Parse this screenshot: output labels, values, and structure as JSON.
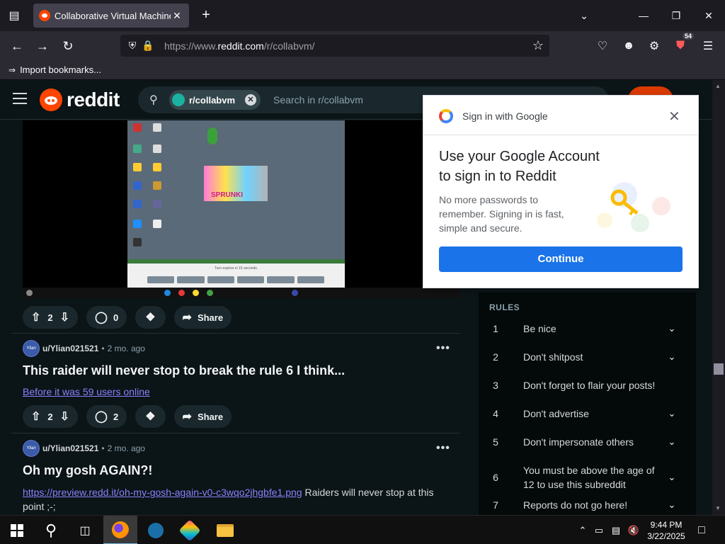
{
  "browser": {
    "tab_title": "Collaborative Virtual Machines!",
    "url_prefix": "https://www.",
    "url_domain": "reddit.com",
    "url_path": "/r/collabvm/",
    "extension_badge": "54",
    "bookmarks_item": "Import bookmarks..."
  },
  "reddit": {
    "logo_text": "reddit",
    "subreddit_chip": "r/collabvm",
    "search_placeholder": "Search in r/collabvm"
  },
  "vm_preview": {
    "art_text": "SPRUNKI",
    "message": "Turn expires in 15 seconds."
  },
  "posts": [
    {
      "upvotes": "2",
      "comments": "0",
      "share_label": "Share"
    },
    {
      "author": "u/Ylian021521",
      "time": "2 mo. ago",
      "title": "This raider will never stop to break the rule 6 I think...",
      "link_text": "Before it was 59 users online",
      "upvotes": "2",
      "comments": "2",
      "share_label": "Share"
    },
    {
      "author": "u/Ylian021521",
      "time": "2 mo. ago",
      "title": "Oh my gosh AGAIN?!",
      "link_text": "https://preview.redd.it/oh-my-gosh-again-v0-c3wqo2jhgbfe1.png",
      "body_text": " Raiders will never stop at this point ;-;"
    }
  ],
  "avatar_text": "Ylian",
  "sidebar": {
    "rules_title": "RULES",
    "rules": [
      {
        "num": "1",
        "text": "Be nice",
        "expandable": true
      },
      {
        "num": "2",
        "text": "Don't shitpost",
        "expandable": true
      },
      {
        "num": "3",
        "text": "Don't forget to flair your posts!",
        "expandable": false
      },
      {
        "num": "4",
        "text": "Don't advertise",
        "expandable": true
      },
      {
        "num": "5",
        "text": "Don't impersonate others",
        "expandable": true
      },
      {
        "num": "6",
        "text": "You must be above the age of 12 to use this subreddit",
        "expandable": true
      },
      {
        "num": "7",
        "text": "Reports do not go here!",
        "expandable": true
      }
    ]
  },
  "google_popup": {
    "header": "Sign in with Google",
    "title": "Use your Google Account to sign in to Reddit",
    "description": "No more passwords to remember. Signing in is fast, simple and secure.",
    "continue_label": "Continue"
  },
  "taskbar": {
    "time": "9:44 PM",
    "date": "3/22/2025"
  },
  "colors": {
    "reddit_orange": "#ff4500",
    "google_blue": "#1a73e8",
    "link_purple": "#8b80ff"
  }
}
